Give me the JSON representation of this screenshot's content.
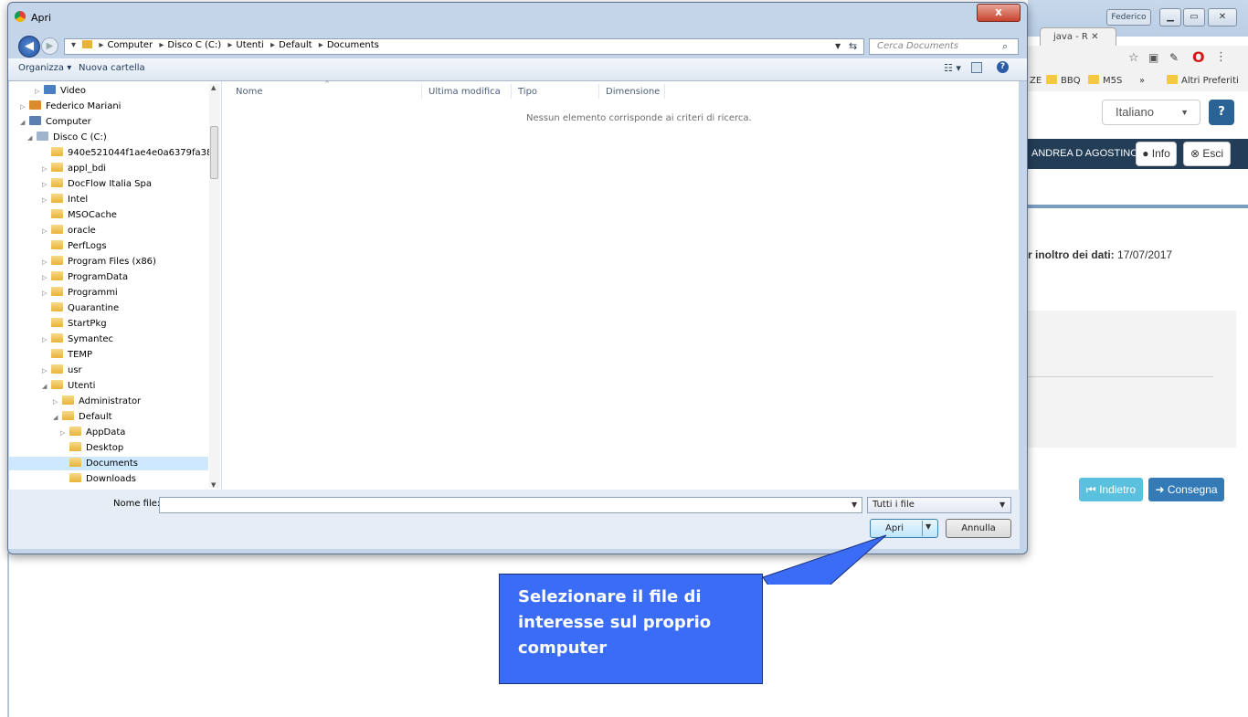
{
  "background_browser": {
    "tab_label": "java - R",
    "user_button": "Federico",
    "bookmarks": [
      "ZE",
      "BBQ",
      "M5S",
      "»",
      "Altri Preferiti"
    ],
    "language_select": "Italiano",
    "user_name": "ANDREA D AGOSTINO",
    "info_label": "Info",
    "logout_label": "Esci",
    "deadline_text": "r inoltro dei dati:",
    "deadline_value": "17/07/2017",
    "back_label": "Indietro",
    "submit_label": "Consegna",
    "colors": {
      "navbar": "#243d57",
      "back_btn": "#5bc0de",
      "submit_btn": "#337ab7"
    }
  },
  "dialog": {
    "title": "Apri",
    "close_label": "x",
    "breadcrumb": [
      "Computer",
      "Disco C (C:)",
      "Utenti",
      "Default",
      "Documents"
    ],
    "search_placeholder": "Cerca Documents",
    "organize_label": "Organizza ▾",
    "new_folder_label": "Nuova cartella",
    "tree": [
      {
        "label": "Video",
        "icon": "video-library-icon"
      },
      {
        "label": "Federico Mariani",
        "icon": "user-folder-icon"
      },
      {
        "label": "Computer",
        "icon": "computer-icon"
      },
      {
        "label": "Disco C (C:)",
        "icon": "drive-icon"
      },
      {
        "label": "940e521044f1ae4e0a6379fa38"
      },
      {
        "label": "appl_bdi"
      },
      {
        "label": "DocFlow Italia Spa"
      },
      {
        "label": "Intel"
      },
      {
        "label": "MSOCache"
      },
      {
        "label": "oracle"
      },
      {
        "label": "PerfLogs"
      },
      {
        "label": "Program Files (x86)"
      },
      {
        "label": "ProgramData"
      },
      {
        "label": "Programmi"
      },
      {
        "label": "Quarantine"
      },
      {
        "label": "StartPkg"
      },
      {
        "label": "Symantec"
      },
      {
        "label": "TEMP"
      },
      {
        "label": "usr"
      },
      {
        "label": "Utenti"
      },
      {
        "label": "Administrator"
      },
      {
        "label": "Default"
      },
      {
        "label": "AppData"
      },
      {
        "label": "Desktop"
      },
      {
        "label": "Documents",
        "selected": true
      },
      {
        "label": "Downloads"
      }
    ],
    "columns": [
      "Nome",
      "Ultima modifica",
      "Tipo",
      "Dimensione"
    ],
    "empty_message": "Nessun elemento corrisponde ai criteri di ricerca.",
    "filename_label": "Nome file:",
    "filename_value": "",
    "filter_value": "Tutti i file",
    "open_label": "Apri",
    "cancel_label": "Annulla"
  },
  "callout": {
    "lines": [
      "Selezionare il file di",
      "interesse sul proprio",
      "computer"
    ],
    "color": "#3b6cf6"
  }
}
